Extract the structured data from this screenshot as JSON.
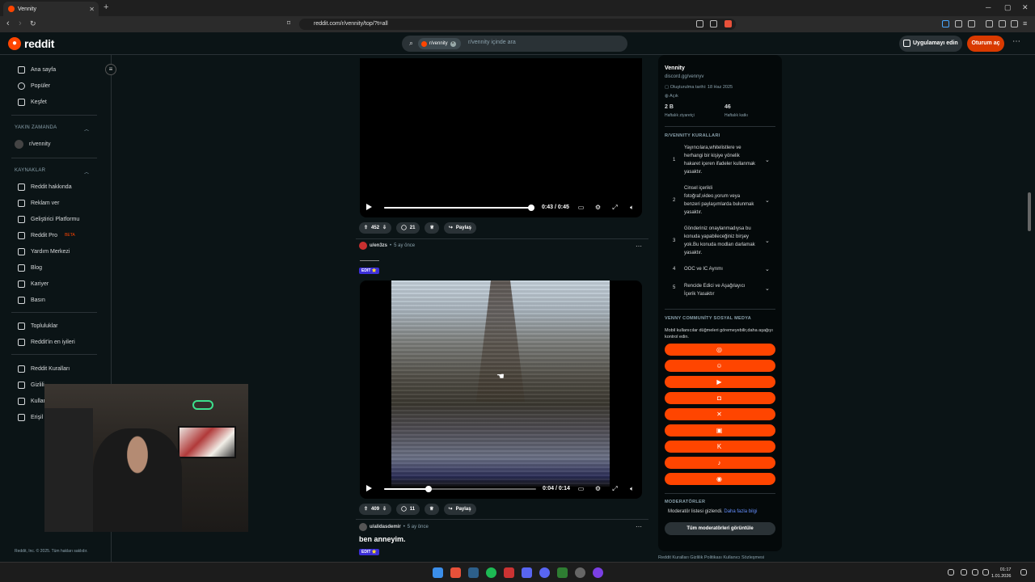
{
  "browser": {
    "tab_title": "Vennity",
    "url": "reddit.com/r/vennity/top/?t=all"
  },
  "header": {
    "logo_text": "reddit",
    "search_chip": "r/vennity",
    "search_placeholder": "r/vennity içinde ara",
    "get_app": "Uygulamayı edin",
    "login": "Oturum aç"
  },
  "sidebar": {
    "items": [
      {
        "label": "Ana sayfa",
        "icon": "home-icon"
      },
      {
        "label": "Popüler",
        "icon": "popular-icon"
      },
      {
        "label": "Keşfet",
        "icon": "explore-icon"
      }
    ],
    "recent_header": "YAKIN ZAMANDA",
    "recent": [
      {
        "label": "r/vennity"
      }
    ],
    "resources_header": "KAYNAKLAR",
    "resources": [
      {
        "label": "Reddit hakkında"
      },
      {
        "label": "Reklam ver"
      },
      {
        "label": "Geliştirici Platformu"
      },
      {
        "label": "Reddit Pro",
        "badge": "BETA"
      },
      {
        "label": "Yardım Merkezi"
      },
      {
        "label": "Blog"
      },
      {
        "label": "Kariyer"
      },
      {
        "label": "Basın"
      }
    ],
    "communities": [
      {
        "label": "Topluluklar"
      },
      {
        "label": "Reddit'in en iyileri"
      }
    ],
    "policies": [
      {
        "label": "Reddit Kuralları"
      },
      {
        "label": "Gizlili"
      },
      {
        "label": "Kullan"
      },
      {
        "label": "Erişil"
      }
    ],
    "copyright": "Reddit, Inc. © 2025. Tüm hakları saklıdır."
  },
  "feed": {
    "post1": {
      "video_time": "0:43 / 0:45",
      "video_progress": 1.0,
      "votes": "452",
      "comments": "21",
      "share": "Paylaş"
    },
    "post2": {
      "author": "u/en3zs",
      "time": "5 ay önce",
      "flair": "EDIT ⭐",
      "video_time": "0:04 / 0:14",
      "video_progress": 0.29,
      "votes": "409",
      "comments": "11",
      "share": "Paylaş"
    },
    "post3": {
      "author": "u/alidasdemir",
      "time": "5 ay önce",
      "title": "ben anneyim.",
      "flair": "EDIT ⭐"
    }
  },
  "community": {
    "name": "Vennity",
    "link": "discord.gg/vennyv",
    "created": "Oluşturulma tarihi: 18 Haz 2025",
    "visibility": "Açık",
    "stat1_value": "2 B",
    "stat1_label": "Haftalık ziyaretçi",
    "stat2_value": "46",
    "stat2_label": "Haftalık katkı",
    "rules_header": "R/VENNITY KURALLARI",
    "rules": [
      {
        "num": "1",
        "text": "Yayıncılara,whitelistlere ve herhangi bir kişiye yönelik hakaret içeren ifadeler kullanmak yasaktır."
      },
      {
        "num": "2",
        "text": "Cinsel içerikli fotoğraf,video,yorum veya benzeri paylaşımlarda bulunmak yasaktır."
      },
      {
        "num": "3",
        "text": "Gönderiniz onaylanmadıysa bu konuda yapabileceğiniz birşey yok.Bu konuda modları darlamak yasaktır."
      },
      {
        "num": "4",
        "text": "OOC ve IC Ayrımı"
      },
      {
        "num": "5",
        "text": "Rencide Edici ve Aşağılayıcı İçerik Yasaktır"
      }
    ],
    "social_header": "VENNY COMMUNİTY SOSYAL MEDYA",
    "social_note": "Mobil kullanıcılar düğmeleri göremeyebilir,daha aşağıyı kontrol edin.",
    "social_buttons": [
      "web-icon",
      "discord-icon",
      "youtube-icon",
      "instagram-icon",
      "x-icon",
      "twitch-icon",
      "kick-icon",
      "tiktok-icon",
      "steam-icon"
    ],
    "moderators_header": "MODERATÖRLER",
    "moderators_note": "Moderatör listesi gizlendi.",
    "moderators_link": "Daha fazla bilgi",
    "moderators_button": "Tüm moderatörleri görüntüle",
    "footer_links": "Reddit Kuralları   Gizlilik Politikası   Kullanıcı Sözleşmesi"
  },
  "taskbar": {
    "time": "01:17",
    "date": "1.01.2026"
  }
}
